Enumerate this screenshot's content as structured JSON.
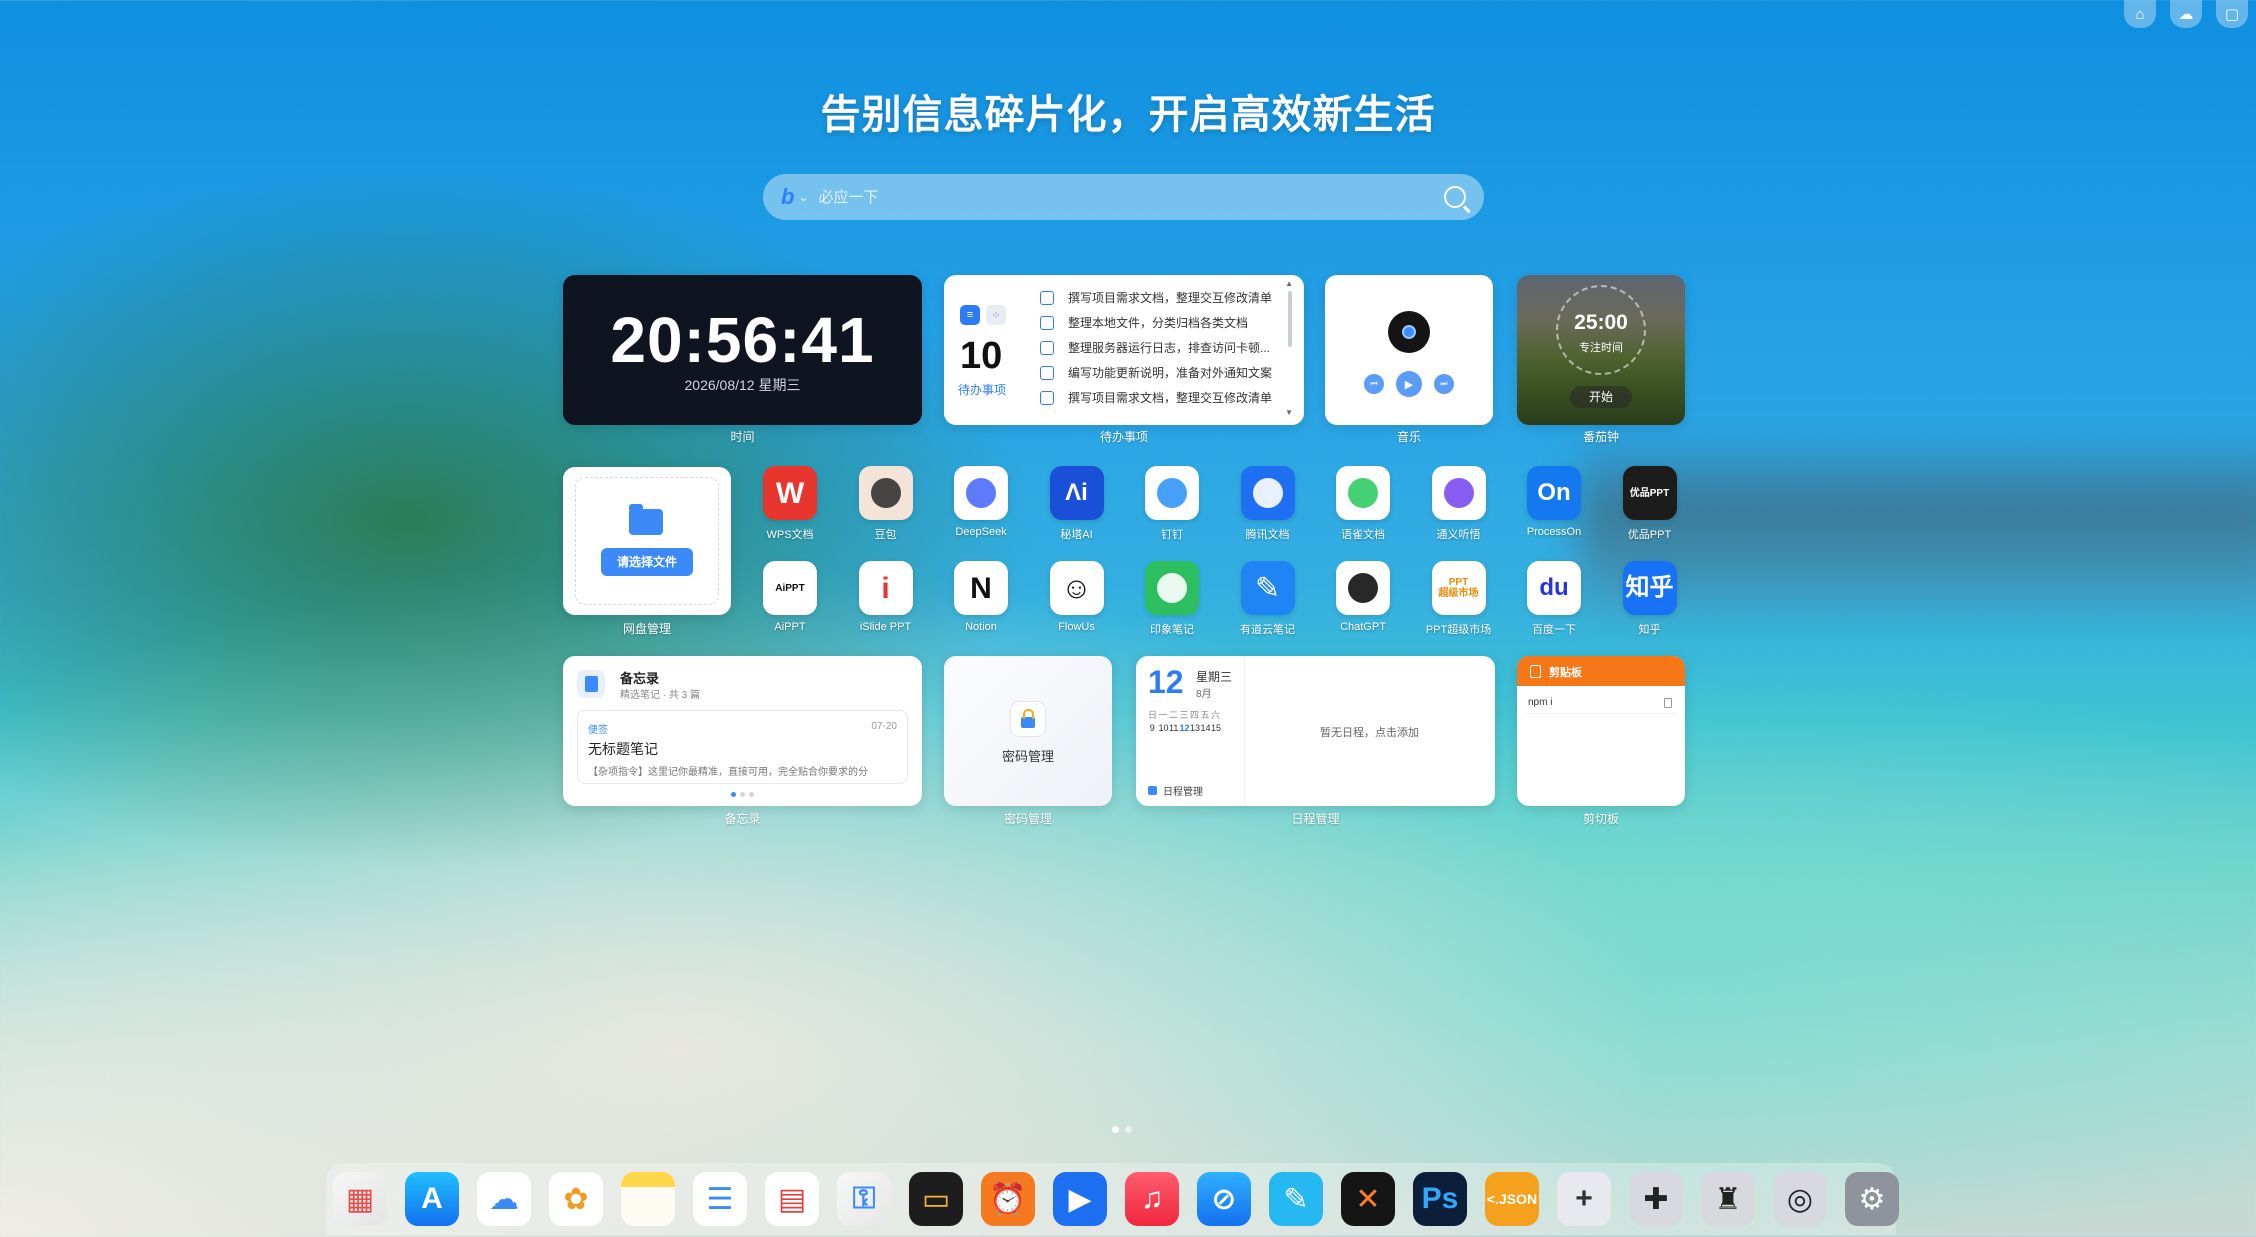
{
  "page_title": "告别信息碎片化，开启高效新生活",
  "search": {
    "placeholder": "必应一下",
    "engine_icon": "bing-icon"
  },
  "top_icons": [
    "home-icon",
    "cloud-icon",
    "window-icon"
  ],
  "clock": {
    "time": "20:56:41",
    "date": "2026/08/12 星期三",
    "caption": "时间"
  },
  "todo": {
    "count": "10",
    "count_label": "待办事项",
    "caption": "待办事项",
    "items": [
      "撰写项目需求文档，整理交互修改清单",
      "整理本地文件，分类归档各类文档",
      "整理服务器运行日志，排查访问卡顿...",
      "编写功能更新说明，准备对外通知文案",
      "撰写项目需求文档，整理交互修改清单"
    ]
  },
  "music": {
    "caption": "音乐"
  },
  "pomodoro": {
    "time": "25:00",
    "label": "专注时间",
    "start": "开始",
    "caption": "番茄钟"
  },
  "disk": {
    "button": "请选择文件",
    "caption": "网盘管理"
  },
  "apps": [
    {
      "name": "WPS文档",
      "icon": "wps-icon",
      "color": "#e8362e"
    },
    {
      "name": "豆包",
      "icon": "doubao-icon",
      "color": "#f4e3d7"
    },
    {
      "name": "DeepSeek",
      "icon": "deepseek-icon",
      "color": "#ffffff"
    },
    {
      "name": "秘塔AI",
      "icon": "metaso-icon",
      "color": "#1a4fd8"
    },
    {
      "name": "钉钉",
      "icon": "dingtalk-icon",
      "color": "#ffffff"
    },
    {
      "name": "腾讯文档",
      "icon": "tencent-docs-icon",
      "color": "#1e6ff2"
    },
    {
      "name": "语雀文档",
      "icon": "yuque-icon",
      "color": "#ffffff"
    },
    {
      "name": "通义听悟",
      "icon": "tingwu-icon",
      "color": "#ffffff"
    },
    {
      "name": "ProcessOn",
      "icon": "processon-icon",
      "color": "#1479ee"
    },
    {
      "name": "优品PPT",
      "icon": "youpin-ppt-icon",
      "color": "#1c1c1c"
    },
    {
      "name": "AiPPT",
      "icon": "aippt-icon",
      "color": "#ffffff"
    },
    {
      "name": "iSlide PPT",
      "icon": "islide-icon",
      "color": "#ffffff"
    },
    {
      "name": "Notion",
      "icon": "notion-icon",
      "color": "#ffffff"
    },
    {
      "name": "FlowUs",
      "icon": "flowus-icon",
      "color": "#ffffff"
    },
    {
      "name": "印象笔记",
      "icon": "evernote-icon",
      "color": "#2dbe60"
    },
    {
      "name": "有道云笔记",
      "icon": "youdao-note-icon",
      "color": "#1f85f5"
    },
    {
      "name": "ChatGPT",
      "icon": "chatgpt-icon",
      "color": "#ffffff"
    },
    {
      "name": "PPT超级市场",
      "icon": "ppt-market-icon",
      "color": "#ffffff"
    },
    {
      "name": "百度一下",
      "icon": "baidu-icon",
      "color": "#ffffff"
    },
    {
      "name": "知乎",
      "icon": "zhihu-icon",
      "color": "#1772f6"
    }
  ],
  "app_glyphs": [
    "W",
    "",
    "",
    "Λi",
    "",
    "",
    "",
    "",
    "On",
    "优品PPT",
    "AiPPT",
    "i",
    "N",
    "☺",
    "",
    "✎",
    "",
    "PPT\n超级市场",
    "du",
    "知乎"
  ],
  "memo": {
    "title": "备忘录",
    "subtitle": "精选笔记 · 共 3 篇",
    "tag": "便签",
    "date": "07-20",
    "note_title": "无标题笔记",
    "note_preview": "【杂项指令】这里记你最精准，直接可用，完全贴合你要求的分",
    "caption": "备忘录"
  },
  "password": {
    "label": "密码管理",
    "caption": "密码管理"
  },
  "schedule": {
    "day": "12",
    "weekday": "星期三",
    "month": "8月",
    "week_header": [
      "日",
      "一",
      "二",
      "三",
      "四",
      "五",
      "六"
    ],
    "week_days": [
      "9",
      "10",
      "11",
      "12",
      "13",
      "14",
      "15"
    ],
    "today_index": 3,
    "empty": "暂无日程，点击添加",
    "footer": "日程管理",
    "caption": "日程管理"
  },
  "clipboard": {
    "header": "剪贴板",
    "items": [
      "npm i"
    ],
    "caption": "剪切板"
  },
  "dock": [
    {
      "icon": "launchpad-icon"
    },
    {
      "icon": "app-store-icon"
    },
    {
      "icon": "icloud-icon"
    },
    {
      "icon": "photos-icon"
    },
    {
      "icon": "notes-icon"
    },
    {
      "icon": "reminders-icon"
    },
    {
      "icon": "calendar-icon"
    },
    {
      "icon": "keychain-icon"
    },
    {
      "icon": "wallet-icon"
    },
    {
      "icon": "clock-icon"
    },
    {
      "icon": "player-icon"
    },
    {
      "icon": "music-icon"
    },
    {
      "icon": "safari-icon"
    },
    {
      "icon": "sketch-icon"
    },
    {
      "icon": "dna-icon"
    },
    {
      "icon": "photoshop-icon"
    },
    {
      "icon": "json-icon"
    },
    {
      "icon": "add-icon"
    },
    {
      "icon": "plugin-icon"
    },
    {
      "icon": "brush-icon"
    },
    {
      "icon": "focus-icon"
    },
    {
      "icon": "settings-icon"
    }
  ],
  "dock_glyphs": {
    "photoshop": "Ps",
    "json": "<.JSON"
  }
}
